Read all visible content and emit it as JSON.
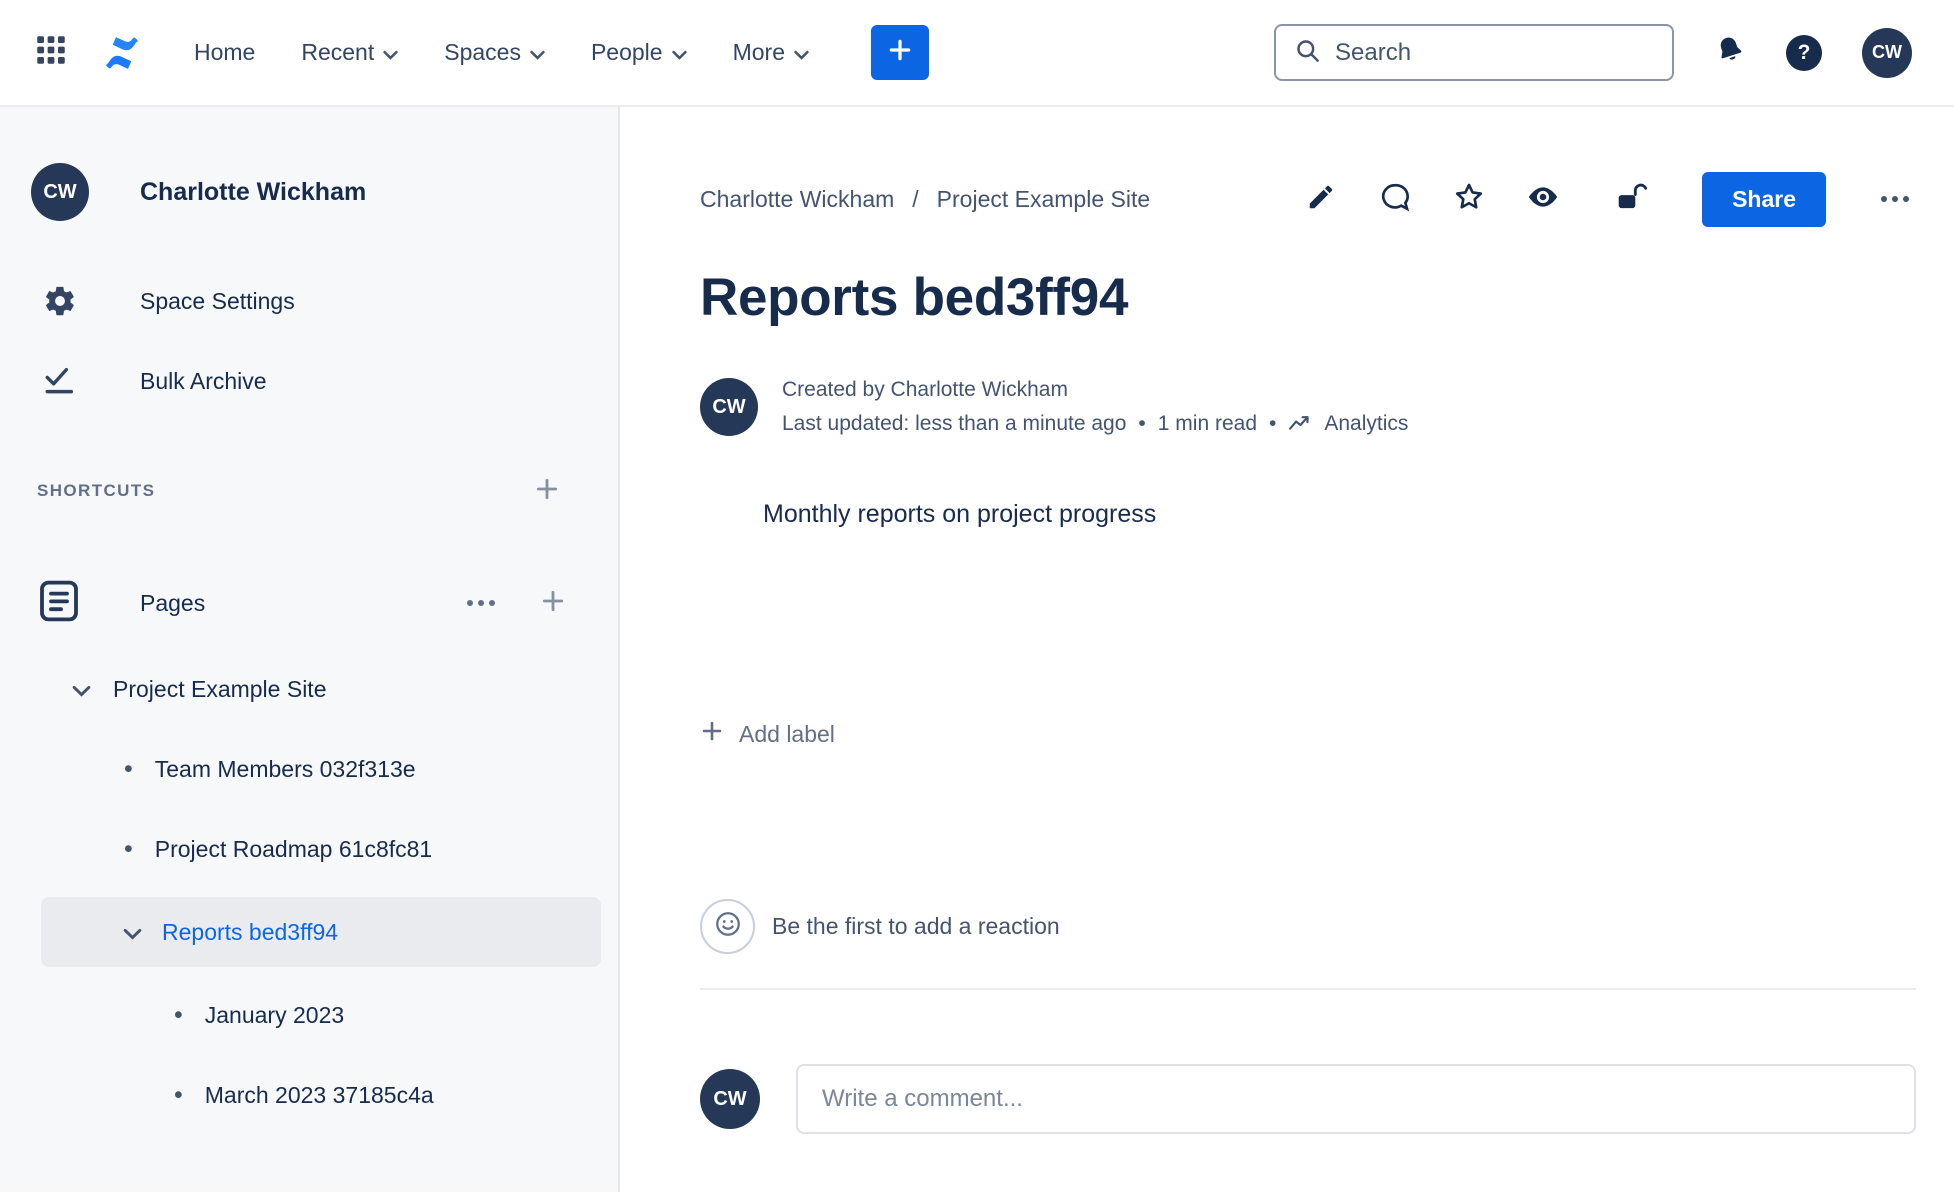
{
  "topnav": {
    "menu": [
      {
        "label": "Home"
      },
      {
        "label": "Recent"
      },
      {
        "label": "Spaces"
      },
      {
        "label": "People"
      },
      {
        "label": "More"
      }
    ],
    "search": {
      "placeholder": "Search"
    },
    "avatar_initials": "CW"
  },
  "sidebar": {
    "avatar_initials": "CW",
    "user_name": "Charlotte Wickham",
    "space_settings_label": "Space Settings",
    "bulk_archive_label": "Bulk Archive",
    "shortcuts_label": "SHORTCUTS",
    "pages_label": "Pages",
    "tree": {
      "root_label": "Project Example Site",
      "child1_label": "Team Members 032f313e",
      "child2_label": "Project Roadmap 61c8fc81",
      "selected_label": "Reports bed3ff94",
      "grandchild1_label": "January 2023",
      "grandchild2_label": "March 2023 37185c4a"
    }
  },
  "main": {
    "breadcrumb": {
      "part1": "Charlotte Wickham",
      "separator": "/",
      "part2": "Project Example Site"
    },
    "share_label": "Share",
    "title": "Reports bed3ff94",
    "byline": {
      "avatar_initials": "CW",
      "created_line": "Created by Charlotte Wickham",
      "updated_text": "Last updated: less than a minute ago",
      "dot": "•",
      "read_time": "1 min read",
      "analytics_label": "Analytics"
    },
    "body_text": "Monthly reports on project progress",
    "add_label_text": "Add label",
    "reaction_prompt": "Be the first to add a reaction",
    "comment": {
      "avatar_initials": "CW",
      "placeholder": "Write a comment..."
    }
  },
  "colors": {
    "accent_blue": "#0C66E4",
    "text_dark": "#172B4D",
    "text_gray": "#626F86",
    "sidebar_bg": "#F7F8F9",
    "selected_item_bg": "#E9EBEE",
    "avatar_bg": "#253858"
  }
}
